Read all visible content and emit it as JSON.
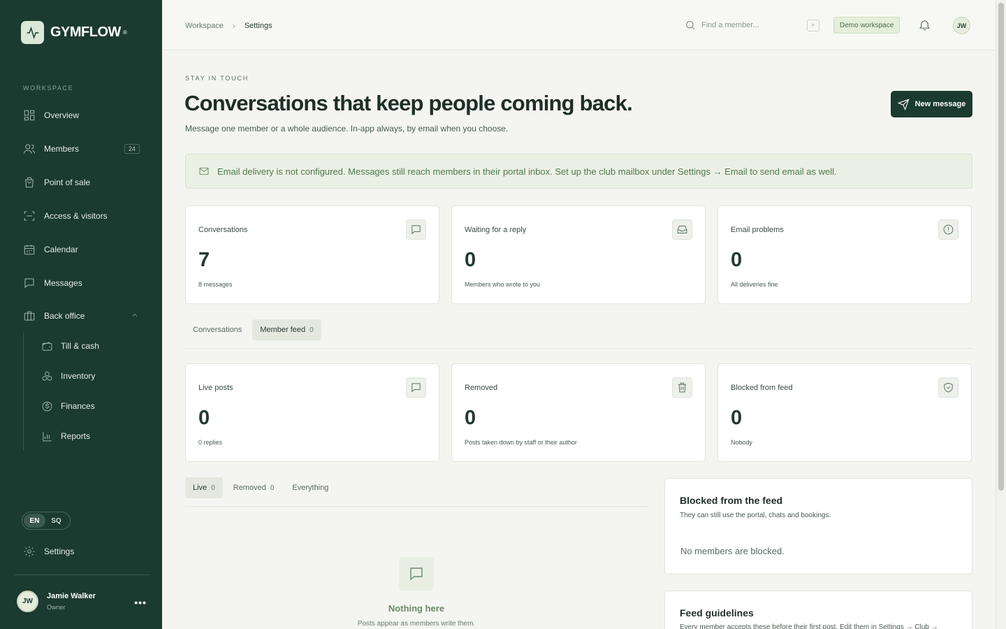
{
  "brand": {
    "name": "GYMFLOW",
    "reg": "®"
  },
  "sidebar": {
    "section_label": "WORKSPACE",
    "items": [
      {
        "label": "Overview",
        "icon": "grid-icon"
      },
      {
        "label": "Members",
        "icon": "users-icon",
        "badge": "24"
      },
      {
        "label": "Point of sale",
        "icon": "bag-icon"
      },
      {
        "label": "Access & visitors",
        "icon": "scan-icon"
      },
      {
        "label": "Calendar",
        "icon": "calendar-icon"
      },
      {
        "label": "Messages",
        "icon": "message-icon"
      },
      {
        "label": "Back office",
        "icon": "briefcase-icon",
        "expanded": true
      }
    ],
    "subitems": [
      {
        "label": "Till & cash",
        "icon": "wallet-icon"
      },
      {
        "label": "Inventory",
        "icon": "boxes-icon"
      },
      {
        "label": "Finances",
        "icon": "dollar-icon"
      },
      {
        "label": "Reports",
        "icon": "bar-chart-icon"
      }
    ],
    "languages": [
      "EN",
      "SQ"
    ],
    "active_language": "EN",
    "settings_label": "Settings",
    "user": {
      "initials": "JW",
      "name": "Jamie Walker",
      "role": "Owner",
      "menu": "•••"
    }
  },
  "topbar": {
    "breadcrumb": [
      "Workspace",
      "Settings"
    ],
    "breadcrumb_sep": "›",
    "search_placeholder": "Find a member...",
    "search_key": "⌕",
    "workspace_badge": "Demo workspace",
    "user_initials": "JW"
  },
  "header": {
    "eyebrow": "STAY IN TOUCH",
    "title": "Conversations that keep people coming back.",
    "subtitle": "Message one member or a whole audience. In-app always, by email when you choose.",
    "new_message": "New message"
  },
  "alert": {
    "text": "Email delivery is not configured. Messages still reach members in their portal inbox. Set up the club mailbox under Settings → Email to send email as well."
  },
  "stats": [
    {
      "label": "Conversations",
      "value": "7",
      "sub": "8 messages",
      "icon": "message-icon"
    },
    {
      "label": "Waiting for a reply",
      "value": "0",
      "sub": "Members who wrote to you",
      "icon": "inbox-icon"
    },
    {
      "label": "Email problems",
      "value": "0",
      "sub": "All deliveries fine",
      "icon": "alert-circle-icon"
    }
  ],
  "main_tabs": [
    {
      "label": "Conversations",
      "count": "",
      "active": false
    },
    {
      "label": "Member feed",
      "count": "0",
      "active": true
    }
  ],
  "feed_stats": [
    {
      "label": "Live posts",
      "value": "0",
      "sub": "0 replies",
      "icon": "message-icon"
    },
    {
      "label": "Removed",
      "value": "0",
      "sub": "Posts taken down by staff or their author",
      "icon": "trash-icon"
    },
    {
      "label": "Blocked from feed",
      "value": "0",
      "sub": "Nobody",
      "icon": "shield-check-icon"
    }
  ],
  "feed_tabs": [
    {
      "label": "Live",
      "count": "0",
      "active": true
    },
    {
      "label": "Removed",
      "count": "0",
      "active": false
    },
    {
      "label": "Everything",
      "count": "",
      "active": false
    }
  ],
  "empty": {
    "title": "Nothing here",
    "subtitle": "Posts appear as members write them."
  },
  "blocked_panel": {
    "title": "Blocked from the feed",
    "subtitle": "They can still use the portal, chats and bookings.",
    "body": "No members are blocked."
  },
  "guidelines_panel": {
    "title": "Feed guidelines",
    "subtitle": "Every member accepts these before their first post. Edit them in Settings → Club →"
  }
}
